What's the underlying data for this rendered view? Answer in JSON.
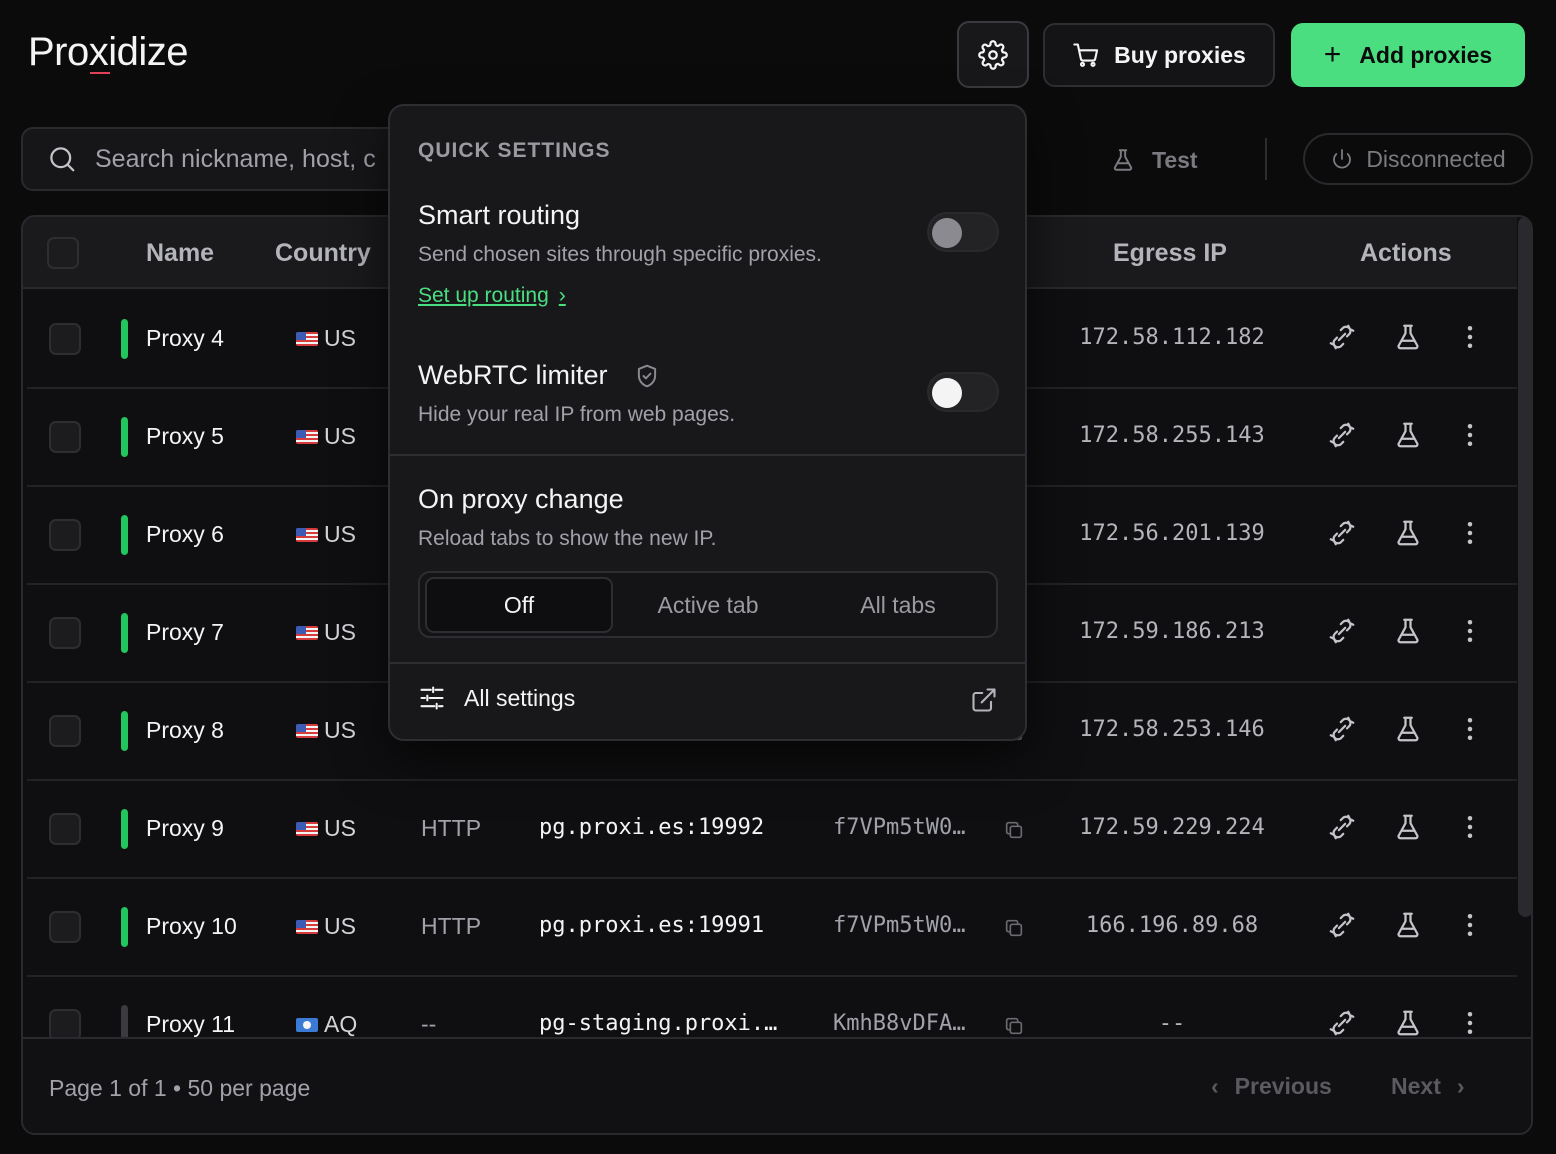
{
  "header": {
    "logo": "Proxidize",
    "settings_icon": "gear-icon",
    "buy_label": "Buy proxies",
    "add_label": "Add proxies",
    "add_color": "#4ade80"
  },
  "toolbar": {
    "search_placeholder": "Search nickname, host, country…",
    "search_visible": "Search nickname, host, c",
    "test_label": "Test",
    "connection_label": "Disconnected"
  },
  "table": {
    "columns": [
      "Name",
      "Country",
      "Egress IP",
      "Actions"
    ],
    "rows": [
      {
        "name": "Proxy 4",
        "country": "US",
        "protocol": "",
        "host": "",
        "user": "",
        "egress": "172.58.112.182",
        "active": true
      },
      {
        "name": "Proxy 5",
        "country": "US",
        "protocol": "",
        "host": "",
        "user": "",
        "egress": "172.58.255.143",
        "active": true
      },
      {
        "name": "Proxy 6",
        "country": "US",
        "protocol": "",
        "host": "",
        "user": "",
        "egress": "172.56.201.139",
        "active": true
      },
      {
        "name": "Proxy 7",
        "country": "US",
        "protocol": "",
        "host": "",
        "user": "",
        "egress": "172.59.186.213",
        "active": true
      },
      {
        "name": "Proxy 8",
        "country": "US",
        "protocol": "",
        "host": "",
        "user": "",
        "egress": "172.58.253.146",
        "active": true
      },
      {
        "name": "Proxy 9",
        "country": "US",
        "protocol": "HTTP",
        "host": "pg.proxi.es:19992",
        "user": "f7VPm5tW0…",
        "egress": "172.59.229.224",
        "active": true
      },
      {
        "name": "Proxy 10",
        "country": "US",
        "protocol": "HTTP",
        "host": "pg.proxi.es:19991",
        "user": "f7VPm5tW0…",
        "egress": "166.196.89.68",
        "active": true
      },
      {
        "name": "Proxy 11",
        "country": "AQ",
        "protocol": "--",
        "host": "pg-staging.proxi.…",
        "user": "KmhB8vDFA…",
        "egress": "--",
        "active": false
      }
    ]
  },
  "footer": {
    "page_info": "Page 1 of 1 • 50 per page",
    "previous_label": "Previous",
    "next_label": "Next"
  },
  "quick_settings": {
    "title": "QUICK SETTINGS",
    "smart_routing": {
      "title": "Smart routing",
      "description": "Send chosen sites through specific proxies.",
      "link": "Set up routing",
      "enabled": false
    },
    "webrtc": {
      "title": "WebRTC limiter",
      "description": "Hide your real IP from web pages.",
      "enabled": false
    },
    "proxy_change": {
      "title": "On proxy change",
      "description": "Reload tabs to show the new IP.",
      "options": [
        "Off",
        "Active tab",
        "All tabs"
      ],
      "selected": "Off"
    },
    "all_settings_label": "All settings"
  }
}
